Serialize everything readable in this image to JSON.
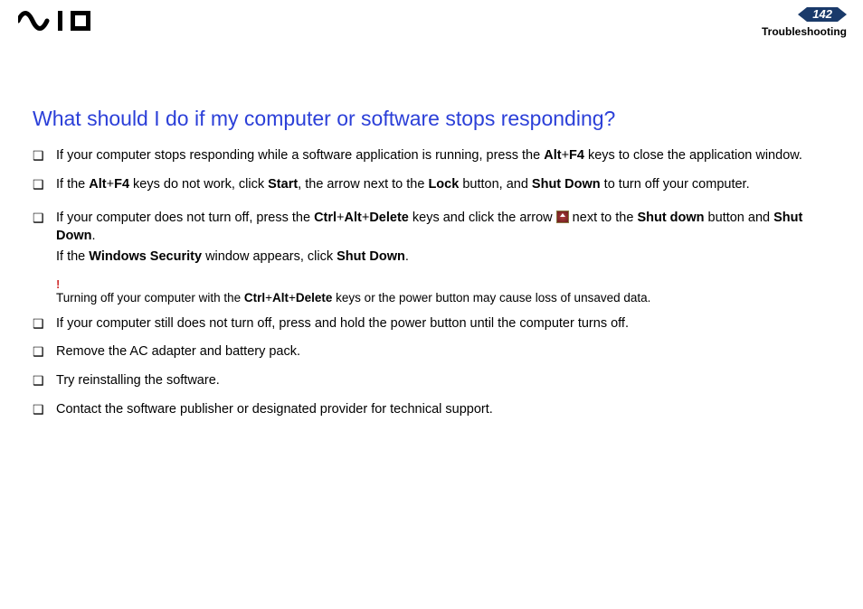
{
  "header": {
    "page_number": "142",
    "section": "Troubleshooting"
  },
  "title": "What should I do if my computer or software stops responding?",
  "items": {
    "b1_pre": "If your computer stops responding while a software application is running, press the ",
    "b1_k1": "Alt",
    "b1_plus": "+",
    "b1_k2": "F4",
    "b1_post": " keys to close the application window.",
    "b2_pre": "If the ",
    "b2_k1": "Alt",
    "b2_k2": "F4",
    "b2_mid1": " keys do not work, click ",
    "b2_start": "Start",
    "b2_mid2": ", the arrow next to the ",
    "b2_lock": "Lock",
    "b2_mid3": " button, and ",
    "b2_shut": "Shut Down",
    "b2_post": " to turn off your computer.",
    "b3_pre": "If your computer does not turn off, press the ",
    "b3_k1": "Ctrl",
    "b3_k2": "Alt",
    "b3_k3": "Delete",
    "b3_mid1": " keys and click the arrow ",
    "b3_mid2": " next to the ",
    "b3_shut1": "Shut down",
    "b3_mid3": " button and ",
    "b3_shut2": "Shut Down",
    "b3_dot": ".",
    "b3_line2_pre": "If the ",
    "b3_ws": "Windows Security",
    "b3_line2_mid": " window appears, click ",
    "b3_line2_shut": "Shut Down",
    "b3_line2_post": ".",
    "warn_pre": "Turning off your computer with the ",
    "warn_k1": "Ctrl",
    "warn_k2": "Alt",
    "warn_k3": "Delete",
    "warn_post": " keys or the power button may cause loss of unsaved data.",
    "b4": "If your computer still does not turn off, press and hold the power button until the computer turns off.",
    "b5": "Remove the AC adapter and battery pack.",
    "b6": "Try reinstalling the software.",
    "b7": "Contact the software publisher or designated provider for technical support."
  },
  "symbols": {
    "plus": "+",
    "bang": "!"
  }
}
